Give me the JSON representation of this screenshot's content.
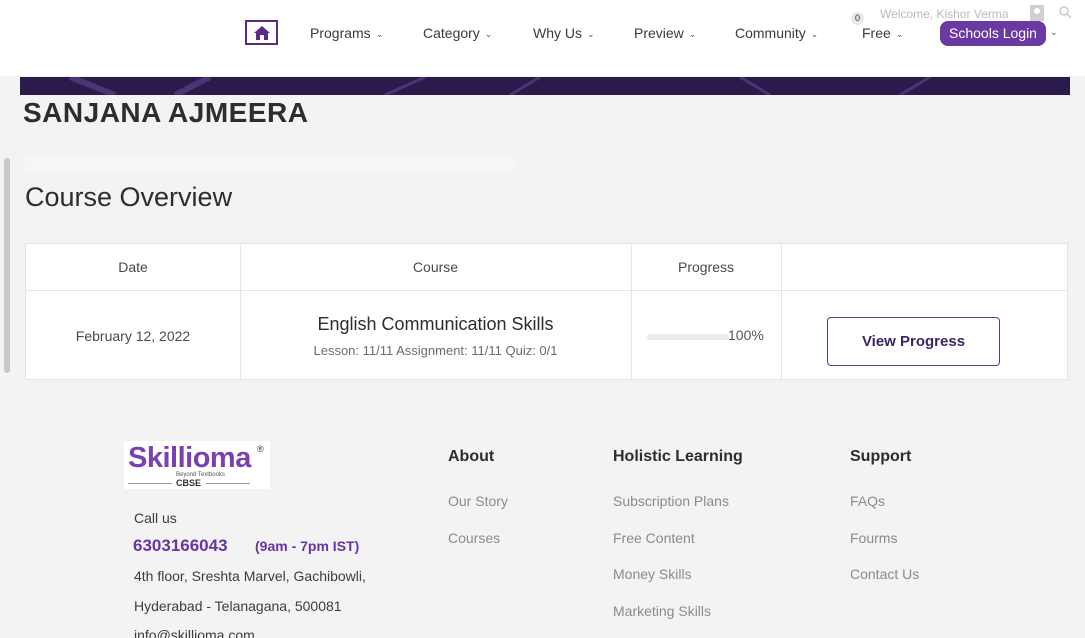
{
  "header": {
    "nav": [
      {
        "label": "Programs"
      },
      {
        "label": "Category"
      },
      {
        "label": "Why Us"
      },
      {
        "label": "Preview"
      },
      {
        "label": "Community"
      },
      {
        "label": "Free"
      }
    ],
    "cart_count": "0",
    "welcome_text": "Welcome, Kishor Verma",
    "login_label": "Schools Login"
  },
  "student": {
    "name": "SANJANA AJMEERA"
  },
  "overview": {
    "title": "Course Overview",
    "columns": [
      "Date",
      "Course",
      "Progress",
      ""
    ],
    "rows": [
      {
        "date": "February 12, 2022",
        "course": "English Communication Skills",
        "meta": "Lesson: 11/11 Assignment: 11/11 Quiz: 0/1",
        "progress_text": "100%",
        "progress_value": 1.0,
        "action": "View Progress"
      }
    ]
  },
  "footer": {
    "logo": {
      "word": "Skillioma",
      "reg": "®",
      "tagline": "Beyond Textbooks",
      "board": "CBSE"
    },
    "call_label": "Call us",
    "phone": "6303166043",
    "hours": "(9am - 7pm IST)",
    "address_line1": "4th floor, Sreshta Marvel, Gachibowli,",
    "address_line2": "Hyderabad - Telanagana, 500081",
    "email": "info@skillioma.com",
    "columns": [
      {
        "heading": "About",
        "links": [
          "Our Story",
          "Courses"
        ]
      },
      {
        "heading": "Holistic Learning",
        "links": [
          "Subscription Plans",
          "Free Content",
          "Money Skills",
          "Marketing Skills"
        ]
      },
      {
        "heading": "Support",
        "links": [
          "FAQs",
          "Fourms",
          "Contact Us"
        ]
      }
    ]
  },
  "colors": {
    "brand": "#6a3aa2",
    "banner": "#2b1b4c"
  },
  "icons": [
    "home-icon",
    "chevron-down-icon",
    "user-avatar-icon",
    "search-icon"
  ]
}
